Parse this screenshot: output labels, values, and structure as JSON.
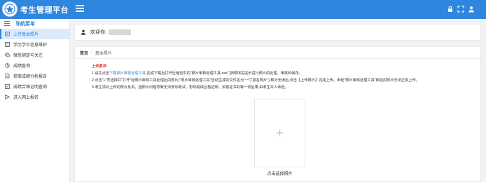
{
  "app": {
    "title": "考生管理平台"
  },
  "sidebar": {
    "header": "导航菜单",
    "items": [
      {
        "label": "上传基本照片",
        "icon": "id-card-icon",
        "active": true
      },
      {
        "label": "学历学位信息维护",
        "icon": "graduation-icon",
        "active": false
      },
      {
        "label": "微信绑定与关注",
        "icon": "wechat-icon",
        "active": false
      },
      {
        "label": "成绩查询",
        "icon": "chart-icon",
        "active": false
      },
      {
        "label": "获取成绩分析报告",
        "icon": "document-icon",
        "active": false
      },
      {
        "label": "成绩合格证明查询",
        "icon": "certificate-icon",
        "active": false
      },
      {
        "label": "进入网上报名",
        "icon": "send-icon",
        "active": false
      }
    ]
  },
  "welcome": {
    "text": "欢迎你:"
  },
  "breadcrumb": {
    "home": "首页",
    "separator": "/",
    "current": "基本照片"
  },
  "requirements": {
    "title": "上传要求:",
    "line1_prefix": "1.请先点击",
    "line1_link": "下载照片审核处理工具",
    "line1_suffix": ",完成下载后打开压缩包中的\"照片审核处理工具.exe\",按照相关提示进行照片的处理、审核和保存。",
    "line2": "2.点击\"+\"号选择并\"打开\"经照片审核工具处理后的照片(\"照片审核处理工具\"自动生成的文件名为\"一寸报名照片\"),核对无误后,点击【上传照片】完成上传。未经\"照片审核处理工具\"核验的照片无法正常上传。",
    "line3": "3.考生须对上传的照片负责。因照片问题导致无法参加考试、影响成绩合格证明、资格证书的等一切后果,由考生本人承担。"
  },
  "upload": {
    "plus": "+",
    "label": "点击选择照片"
  },
  "colors": {
    "primary": "#2e86de",
    "warning": "#e53935"
  }
}
